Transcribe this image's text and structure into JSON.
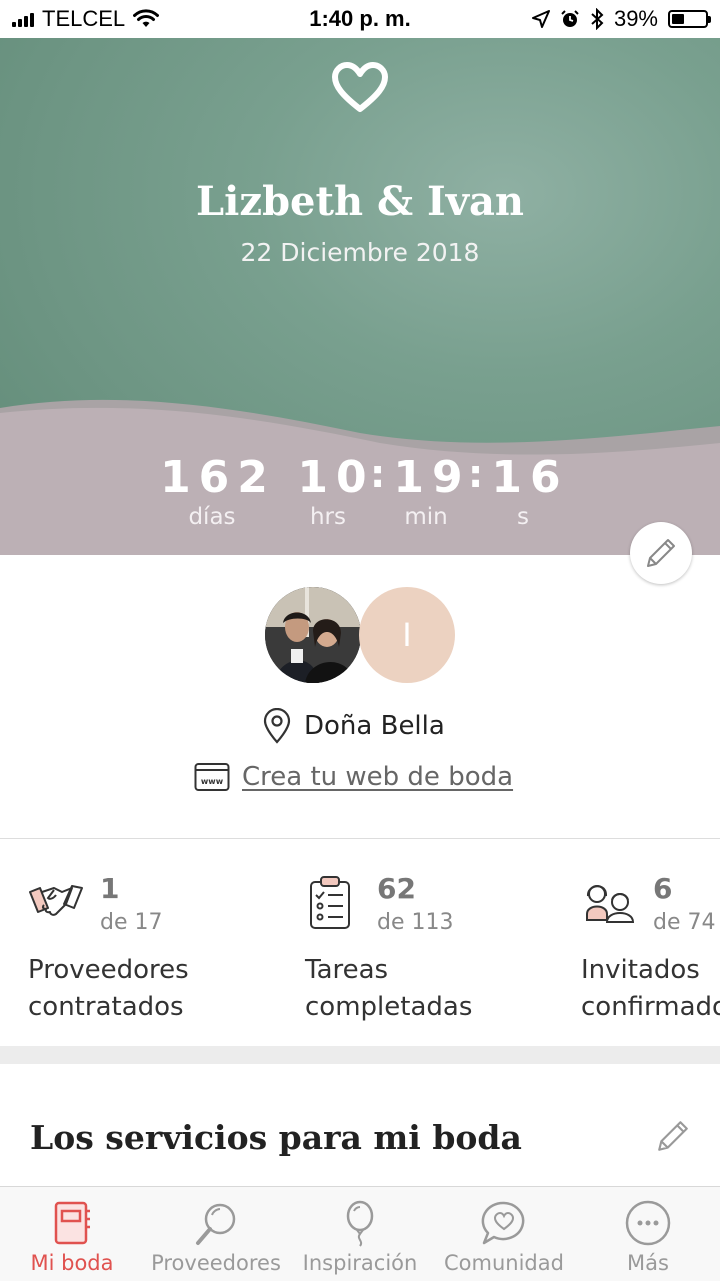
{
  "status_bar": {
    "carrier": "TELCEL",
    "time": "1:40 p. m.",
    "battery": "39%",
    "battery_level": 0.39
  },
  "hero": {
    "couple_names": "Lizbeth & Ivan",
    "wedding_date": "22 Diciembre 2018",
    "countdown": {
      "days": "162",
      "days_label": "días",
      "hours": "10",
      "hours_label": "hrs",
      "minutes": "19",
      "minutes_label": "min",
      "seconds": "16",
      "seconds_label": "s"
    }
  },
  "profile": {
    "partner_initial": "I",
    "venue": "Doña Bella",
    "web_link": "Crea tu web de boda"
  },
  "stats": [
    {
      "value": "1",
      "total": "de 17",
      "label_line1": "Proveedores",
      "label_line2": "contratados",
      "icon": "handshake-icon"
    },
    {
      "value": "62",
      "total": "de 113",
      "label_line1": "Tareas",
      "label_line2": "completadas",
      "icon": "checklist-icon"
    },
    {
      "value": "6",
      "total": "de 74",
      "label_line1": "Invitados",
      "label_line2": "confirmados",
      "icon": "guests-icon"
    }
  ],
  "section": {
    "title": "Los servicios para mi boda"
  },
  "tabs": [
    {
      "label": "Mi boda",
      "icon": "notebook-icon",
      "active": true
    },
    {
      "label": "Proveedores",
      "icon": "magnifier-icon",
      "active": false
    },
    {
      "label": "Inspiración",
      "icon": "balloon-icon",
      "active": false
    },
    {
      "label": "Comunidad",
      "icon": "chat-heart-icon",
      "active": false
    },
    {
      "label": "Más",
      "icon": "more-icon",
      "active": false
    }
  ],
  "colors": {
    "accent": "#e0524f",
    "hero_green": "#6c9482",
    "hero_mauve": "#bcb0b5",
    "avatar_peach": "#ecd2c1"
  }
}
